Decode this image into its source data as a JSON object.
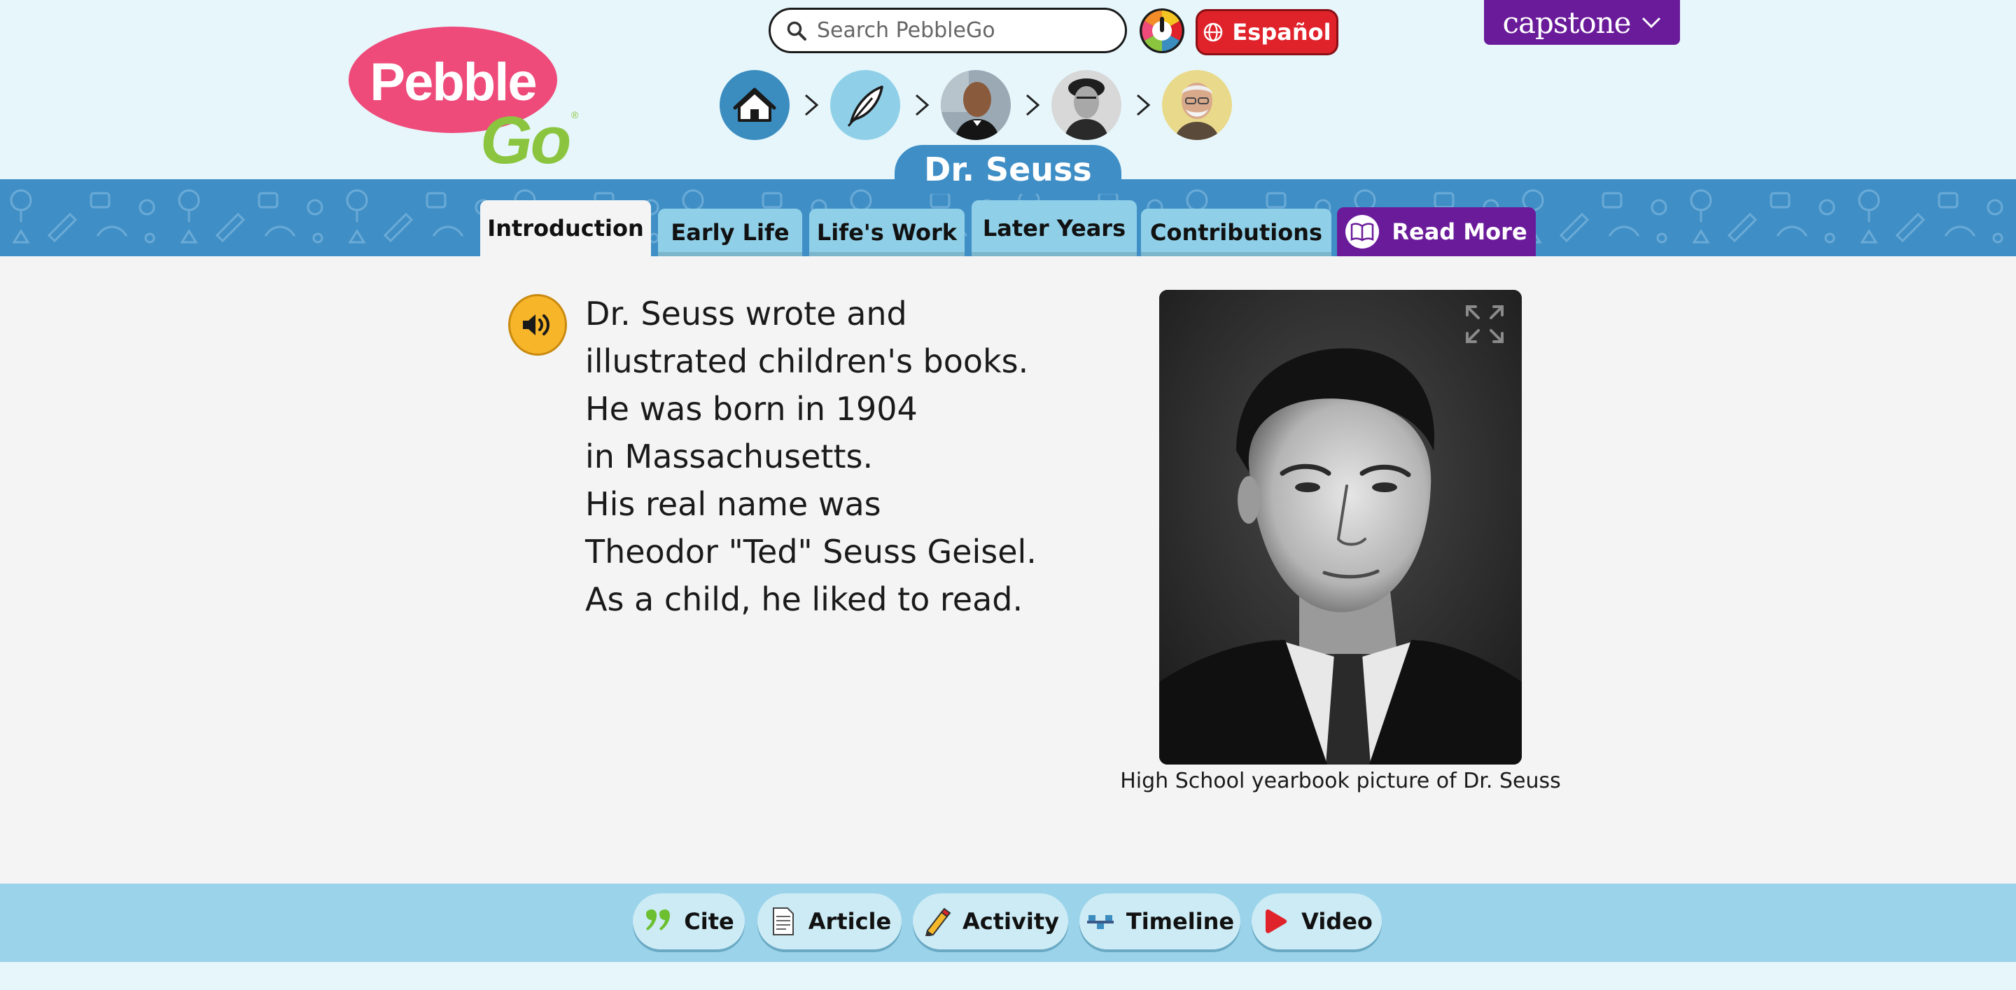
{
  "brand": {
    "logo_top": "Pebble",
    "logo_bottom": "Go",
    "logo_reg": "®",
    "pink": "#ee4a7a",
    "green": "#8bc53f"
  },
  "search": {
    "placeholder": "Search PebbleGo"
  },
  "language_button": {
    "label": "Español",
    "color": "#e0232b"
  },
  "capstone_menu": {
    "label": "capstone",
    "color": "#6a1b9a"
  },
  "breadcrumb": [
    {
      "name": "home-icon"
    },
    {
      "name": "feather-icon"
    },
    {
      "name": "person-thumb-1"
    },
    {
      "name": "person-thumb-2"
    },
    {
      "name": "person-thumb-3"
    }
  ],
  "page": {
    "title": "Dr. Seuss"
  },
  "tabs": [
    {
      "label": "Introduction",
      "active": true
    },
    {
      "label": "Early Life",
      "active": false
    },
    {
      "label": "Life's Work",
      "active": false
    },
    {
      "label": "Later Years",
      "active": false
    },
    {
      "label": "Contributions",
      "active": false
    },
    {
      "label": "Read More",
      "active": false
    }
  ],
  "article": {
    "lines": [
      "Dr. Seuss wrote and",
      "illustrated children's books.",
      "He was born in 1904",
      "in Massachusetts.",
      "His real name was",
      "Theodor \"Ted\" Seuss Geisel.",
      "As a child, he liked to read."
    ]
  },
  "photo": {
    "caption": "High School yearbook picture of Dr. Seuss"
  },
  "footer_buttons": [
    {
      "label": "Cite",
      "icon": "quote-icon"
    },
    {
      "label": "Article",
      "icon": "article-icon"
    },
    {
      "label": "Activity",
      "icon": "pencil-icon"
    },
    {
      "label": "Timeline",
      "icon": "timeline-icon"
    },
    {
      "label": "Video",
      "icon": "play-icon"
    }
  ]
}
